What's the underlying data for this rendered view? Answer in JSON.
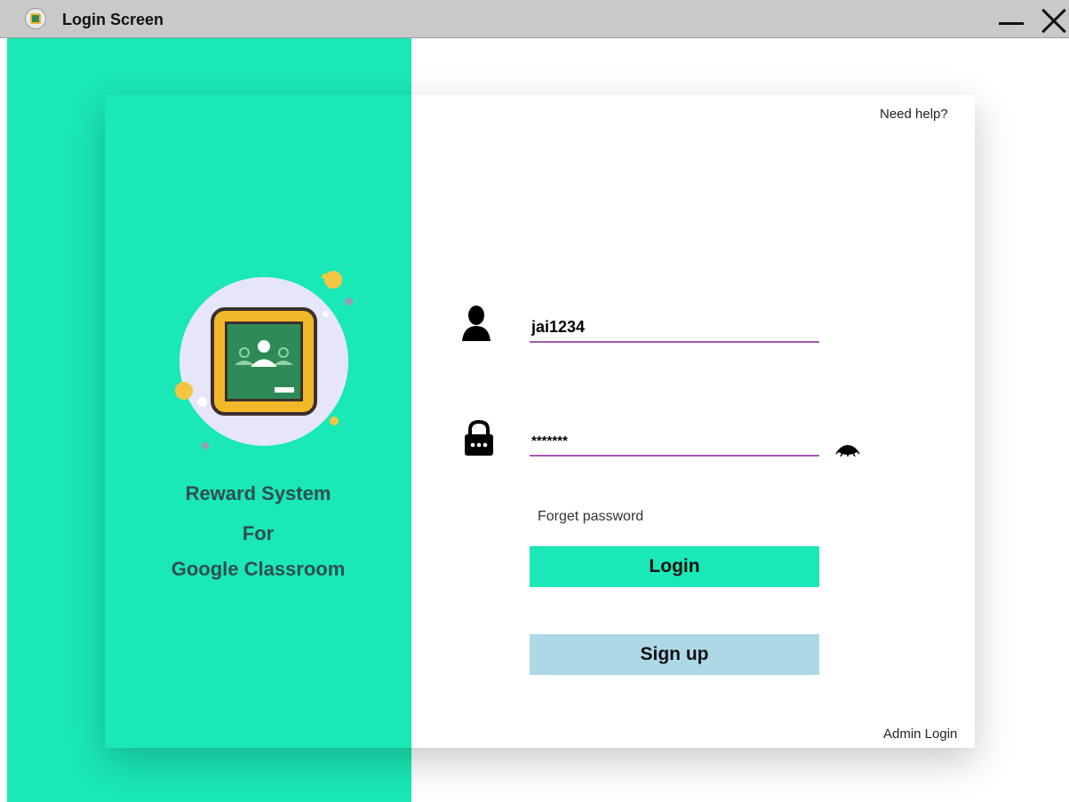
{
  "window": {
    "title": "Login Screen"
  },
  "brand": {
    "line1": "Reward System",
    "line2": "For",
    "line3": "Google Classroom"
  },
  "links": {
    "help": "Need help?",
    "forgot": "Forget password",
    "admin": "Admin Login"
  },
  "form": {
    "username_value": "jai1234",
    "password_masked": "*******"
  },
  "buttons": {
    "login": "Login",
    "signup": "Sign up"
  },
  "colors": {
    "accent": "#1ae8b6",
    "signup": "#add8e6",
    "underline": "#a45ab0"
  }
}
